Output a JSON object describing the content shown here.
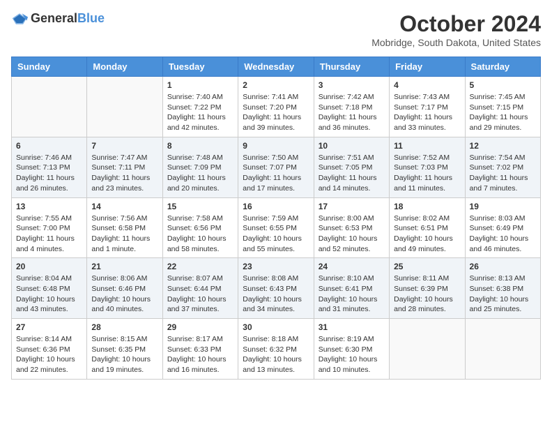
{
  "header": {
    "logo": {
      "text_general": "General",
      "text_blue": "Blue"
    },
    "title": "October 2024",
    "subtitle": "Mobridge, South Dakota, United States"
  },
  "days_of_week": [
    "Sunday",
    "Monday",
    "Tuesday",
    "Wednesday",
    "Thursday",
    "Friday",
    "Saturday"
  ],
  "weeks": [
    [
      {
        "day": "",
        "sunrise": "",
        "sunset": "",
        "daylight": ""
      },
      {
        "day": "",
        "sunrise": "",
        "sunset": "",
        "daylight": ""
      },
      {
        "day": "1",
        "sunrise": "Sunrise: 7:40 AM",
        "sunset": "Sunset: 7:22 PM",
        "daylight": "Daylight: 11 hours and 42 minutes."
      },
      {
        "day": "2",
        "sunrise": "Sunrise: 7:41 AM",
        "sunset": "Sunset: 7:20 PM",
        "daylight": "Daylight: 11 hours and 39 minutes."
      },
      {
        "day": "3",
        "sunrise": "Sunrise: 7:42 AM",
        "sunset": "Sunset: 7:18 PM",
        "daylight": "Daylight: 11 hours and 36 minutes."
      },
      {
        "day": "4",
        "sunrise": "Sunrise: 7:43 AM",
        "sunset": "Sunset: 7:17 PM",
        "daylight": "Daylight: 11 hours and 33 minutes."
      },
      {
        "day": "5",
        "sunrise": "Sunrise: 7:45 AM",
        "sunset": "Sunset: 7:15 PM",
        "daylight": "Daylight: 11 hours and 29 minutes."
      }
    ],
    [
      {
        "day": "6",
        "sunrise": "Sunrise: 7:46 AM",
        "sunset": "Sunset: 7:13 PM",
        "daylight": "Daylight: 11 hours and 26 minutes."
      },
      {
        "day": "7",
        "sunrise": "Sunrise: 7:47 AM",
        "sunset": "Sunset: 7:11 PM",
        "daylight": "Daylight: 11 hours and 23 minutes."
      },
      {
        "day": "8",
        "sunrise": "Sunrise: 7:48 AM",
        "sunset": "Sunset: 7:09 PM",
        "daylight": "Daylight: 11 hours and 20 minutes."
      },
      {
        "day": "9",
        "sunrise": "Sunrise: 7:50 AM",
        "sunset": "Sunset: 7:07 PM",
        "daylight": "Daylight: 11 hours and 17 minutes."
      },
      {
        "day": "10",
        "sunrise": "Sunrise: 7:51 AM",
        "sunset": "Sunset: 7:05 PM",
        "daylight": "Daylight: 11 hours and 14 minutes."
      },
      {
        "day": "11",
        "sunrise": "Sunrise: 7:52 AM",
        "sunset": "Sunset: 7:03 PM",
        "daylight": "Daylight: 11 hours and 11 minutes."
      },
      {
        "day": "12",
        "sunrise": "Sunrise: 7:54 AM",
        "sunset": "Sunset: 7:02 PM",
        "daylight": "Daylight: 11 hours and 7 minutes."
      }
    ],
    [
      {
        "day": "13",
        "sunrise": "Sunrise: 7:55 AM",
        "sunset": "Sunset: 7:00 PM",
        "daylight": "Daylight: 11 hours and 4 minutes."
      },
      {
        "day": "14",
        "sunrise": "Sunrise: 7:56 AM",
        "sunset": "Sunset: 6:58 PM",
        "daylight": "Daylight: 11 hours and 1 minute."
      },
      {
        "day": "15",
        "sunrise": "Sunrise: 7:58 AM",
        "sunset": "Sunset: 6:56 PM",
        "daylight": "Daylight: 10 hours and 58 minutes."
      },
      {
        "day": "16",
        "sunrise": "Sunrise: 7:59 AM",
        "sunset": "Sunset: 6:55 PM",
        "daylight": "Daylight: 10 hours and 55 minutes."
      },
      {
        "day": "17",
        "sunrise": "Sunrise: 8:00 AM",
        "sunset": "Sunset: 6:53 PM",
        "daylight": "Daylight: 10 hours and 52 minutes."
      },
      {
        "day": "18",
        "sunrise": "Sunrise: 8:02 AM",
        "sunset": "Sunset: 6:51 PM",
        "daylight": "Daylight: 10 hours and 49 minutes."
      },
      {
        "day": "19",
        "sunrise": "Sunrise: 8:03 AM",
        "sunset": "Sunset: 6:49 PM",
        "daylight": "Daylight: 10 hours and 46 minutes."
      }
    ],
    [
      {
        "day": "20",
        "sunrise": "Sunrise: 8:04 AM",
        "sunset": "Sunset: 6:48 PM",
        "daylight": "Daylight: 10 hours and 43 minutes."
      },
      {
        "day": "21",
        "sunrise": "Sunrise: 8:06 AM",
        "sunset": "Sunset: 6:46 PM",
        "daylight": "Daylight: 10 hours and 40 minutes."
      },
      {
        "day": "22",
        "sunrise": "Sunrise: 8:07 AM",
        "sunset": "Sunset: 6:44 PM",
        "daylight": "Daylight: 10 hours and 37 minutes."
      },
      {
        "day": "23",
        "sunrise": "Sunrise: 8:08 AM",
        "sunset": "Sunset: 6:43 PM",
        "daylight": "Daylight: 10 hours and 34 minutes."
      },
      {
        "day": "24",
        "sunrise": "Sunrise: 8:10 AM",
        "sunset": "Sunset: 6:41 PM",
        "daylight": "Daylight: 10 hours and 31 minutes."
      },
      {
        "day": "25",
        "sunrise": "Sunrise: 8:11 AM",
        "sunset": "Sunset: 6:39 PM",
        "daylight": "Daylight: 10 hours and 28 minutes."
      },
      {
        "day": "26",
        "sunrise": "Sunrise: 8:13 AM",
        "sunset": "Sunset: 6:38 PM",
        "daylight": "Daylight: 10 hours and 25 minutes."
      }
    ],
    [
      {
        "day": "27",
        "sunrise": "Sunrise: 8:14 AM",
        "sunset": "Sunset: 6:36 PM",
        "daylight": "Daylight: 10 hours and 22 minutes."
      },
      {
        "day": "28",
        "sunrise": "Sunrise: 8:15 AM",
        "sunset": "Sunset: 6:35 PM",
        "daylight": "Daylight: 10 hours and 19 minutes."
      },
      {
        "day": "29",
        "sunrise": "Sunrise: 8:17 AM",
        "sunset": "Sunset: 6:33 PM",
        "daylight": "Daylight: 10 hours and 16 minutes."
      },
      {
        "day": "30",
        "sunrise": "Sunrise: 8:18 AM",
        "sunset": "Sunset: 6:32 PM",
        "daylight": "Daylight: 10 hours and 13 minutes."
      },
      {
        "day": "31",
        "sunrise": "Sunrise: 8:19 AM",
        "sunset": "Sunset: 6:30 PM",
        "daylight": "Daylight: 10 hours and 10 minutes."
      },
      {
        "day": "",
        "sunrise": "",
        "sunset": "",
        "daylight": ""
      },
      {
        "day": "",
        "sunrise": "",
        "sunset": "",
        "daylight": ""
      }
    ]
  ]
}
